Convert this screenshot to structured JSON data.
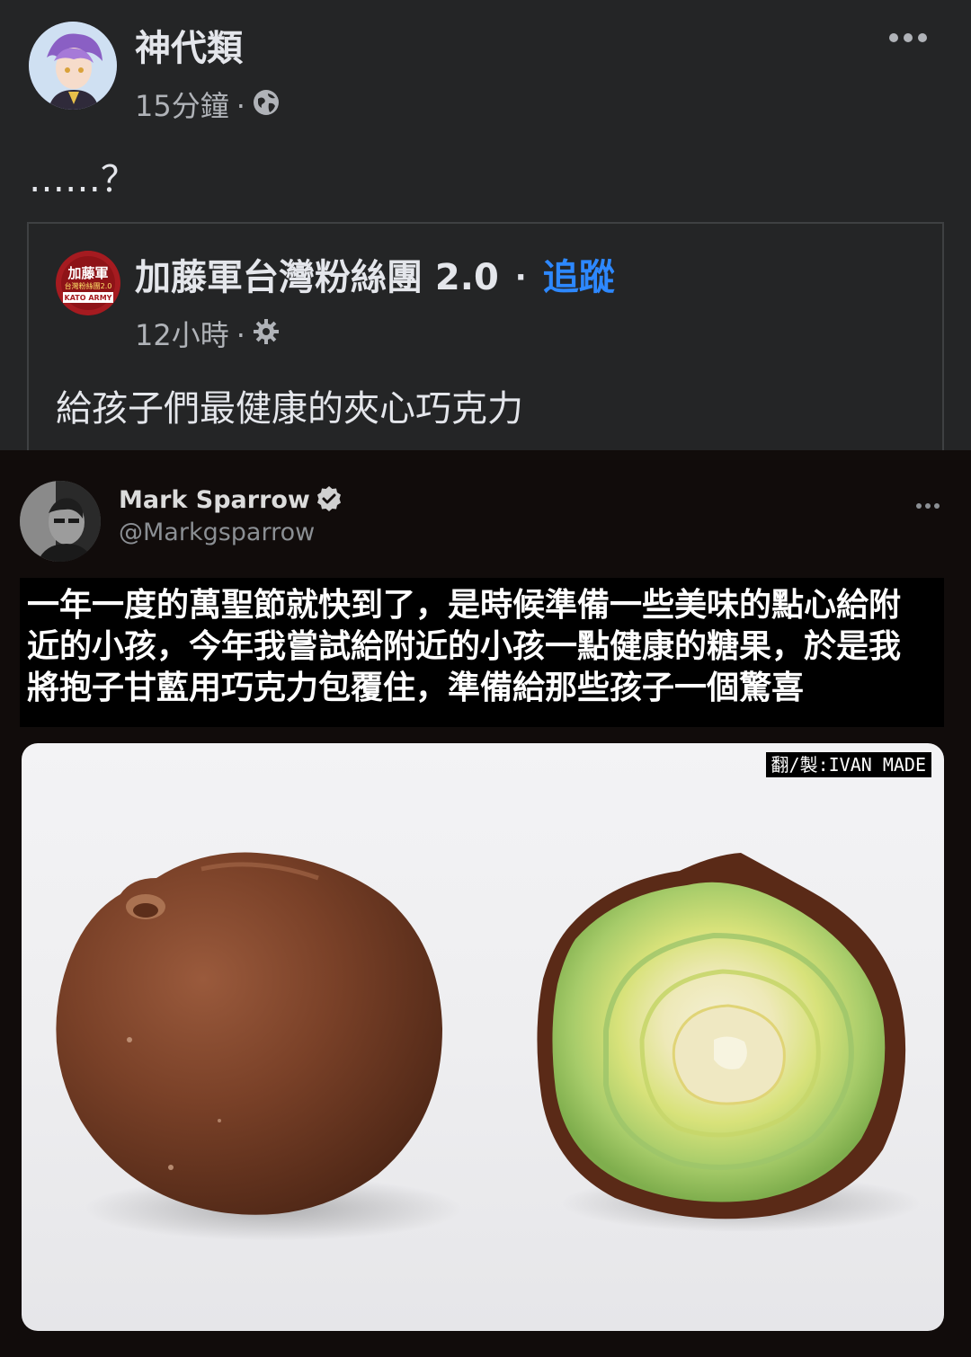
{
  "post": {
    "author": "神代類",
    "time": "15分鐘",
    "meta_sep": "·",
    "privacy_icon": "globe-icon",
    "text": "……？"
  },
  "shared": {
    "page_name": "加藤軍台灣粉絲團 2.0",
    "dot": "·",
    "follow_label": "追蹤",
    "time": "12小時",
    "meta_sep": "·",
    "privacy_icon": "gear-icon",
    "text": "給孩子們最健康的夾心巧克力",
    "avatar_text": {
      "line1": "加藤軍",
      "line2": "台灣粉絲團2.0",
      "line3": "KATO ARMY"
    }
  },
  "tweet": {
    "name": "Mark Sparrow",
    "verified_icon": "verified-badge-icon",
    "handle": "@Markgsparrow",
    "caption_lines": [
      "一年一度的萬聖節就快到了，是時候準備一些美味的點心給附",
      "近的小孩，今年我嘗試給附近的小孩一點健康的糖果，於是我",
      "將抱子甘藍用巧克力包覆住，準備給那些孩子一個驚喜"
    ],
    "watermark": "翻/製:IVAN MADE"
  },
  "colors": {
    "background": "#242526",
    "primary_text": "#e4e6eb",
    "secondary_text": "#b0b3b8",
    "link": "#2d88ff",
    "border": "#3e4042",
    "tweet_bg": "#110c0b",
    "chocolate": "#6b3a24",
    "sprout_green": "#9cc46a"
  }
}
